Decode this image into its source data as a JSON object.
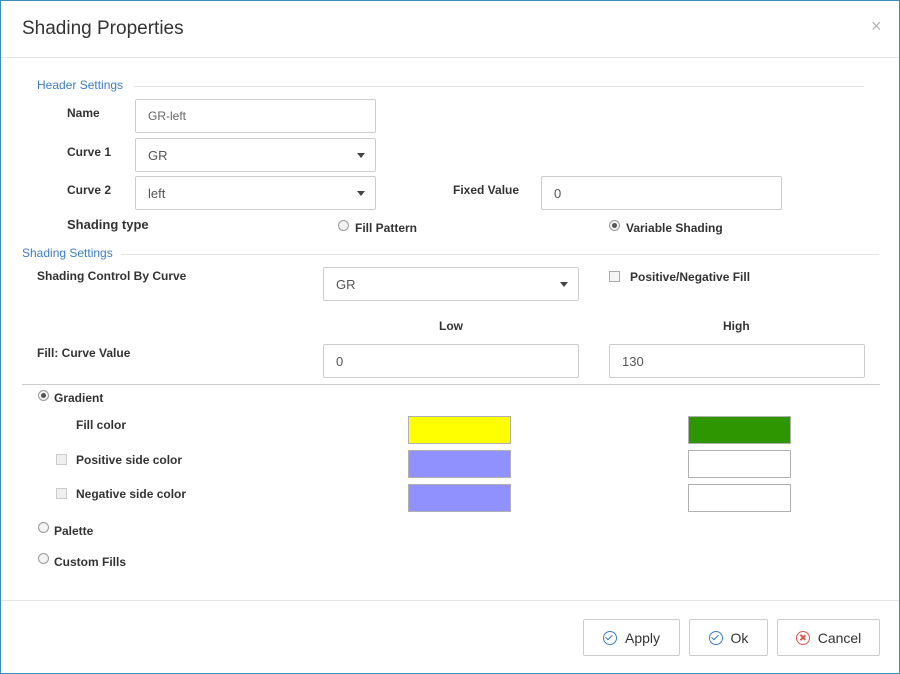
{
  "dialog": {
    "title": "Shading Properties",
    "close_glyph": "×"
  },
  "header_settings": {
    "section_title": "Header Settings",
    "name_label": "Name",
    "name_value": "GR-left",
    "curve1_label": "Curve 1",
    "curve1_value": "GR",
    "curve2_label": "Curve 2",
    "curve2_value": "left",
    "fixed_value_label": "Fixed Value",
    "fixed_value": "0",
    "shading_type_label": "Shading type",
    "fill_pattern_label": "Fill Pattern",
    "variable_shading_label": "Variable Shading",
    "selected_shading_type": "Variable Shading"
  },
  "shading_settings": {
    "section_title": "Shading Settings",
    "control_by_curve_label": "Shading Control By Curve",
    "control_by_curve_value": "GR",
    "pos_neg_fill_label": "Positive/Negative Fill",
    "pos_neg_fill_checked": false,
    "low_header": "Low",
    "high_header": "High",
    "fill_curve_value_label": "Fill: Curve Value",
    "low_value": "0",
    "high_value": "130"
  },
  "fill_mode": {
    "selected": "Gradient",
    "gradient_label": "Gradient",
    "fill_color_label": "Fill color",
    "positive_side_label": "Positive side color",
    "negative_side_label": "Negative side color",
    "palette_label": "Palette",
    "custom_fills_label": "Custom Fills"
  },
  "colors": {
    "fill_low": "#ffff00",
    "fill_high": "#2e9600",
    "positive_low": "#9090ff",
    "positive_high": "#ffffff",
    "negative_low": "#9090ff",
    "negative_high": "#ffffff",
    "section_title": "#3c7dc4"
  },
  "footer": {
    "apply_label": "Apply",
    "ok_label": "Ok",
    "cancel_label": "Cancel"
  },
  "icons": {
    "apply": "check-circle-icon",
    "ok": "check-circle-icon",
    "cancel": "x-circle-icon",
    "close": "close-icon"
  }
}
